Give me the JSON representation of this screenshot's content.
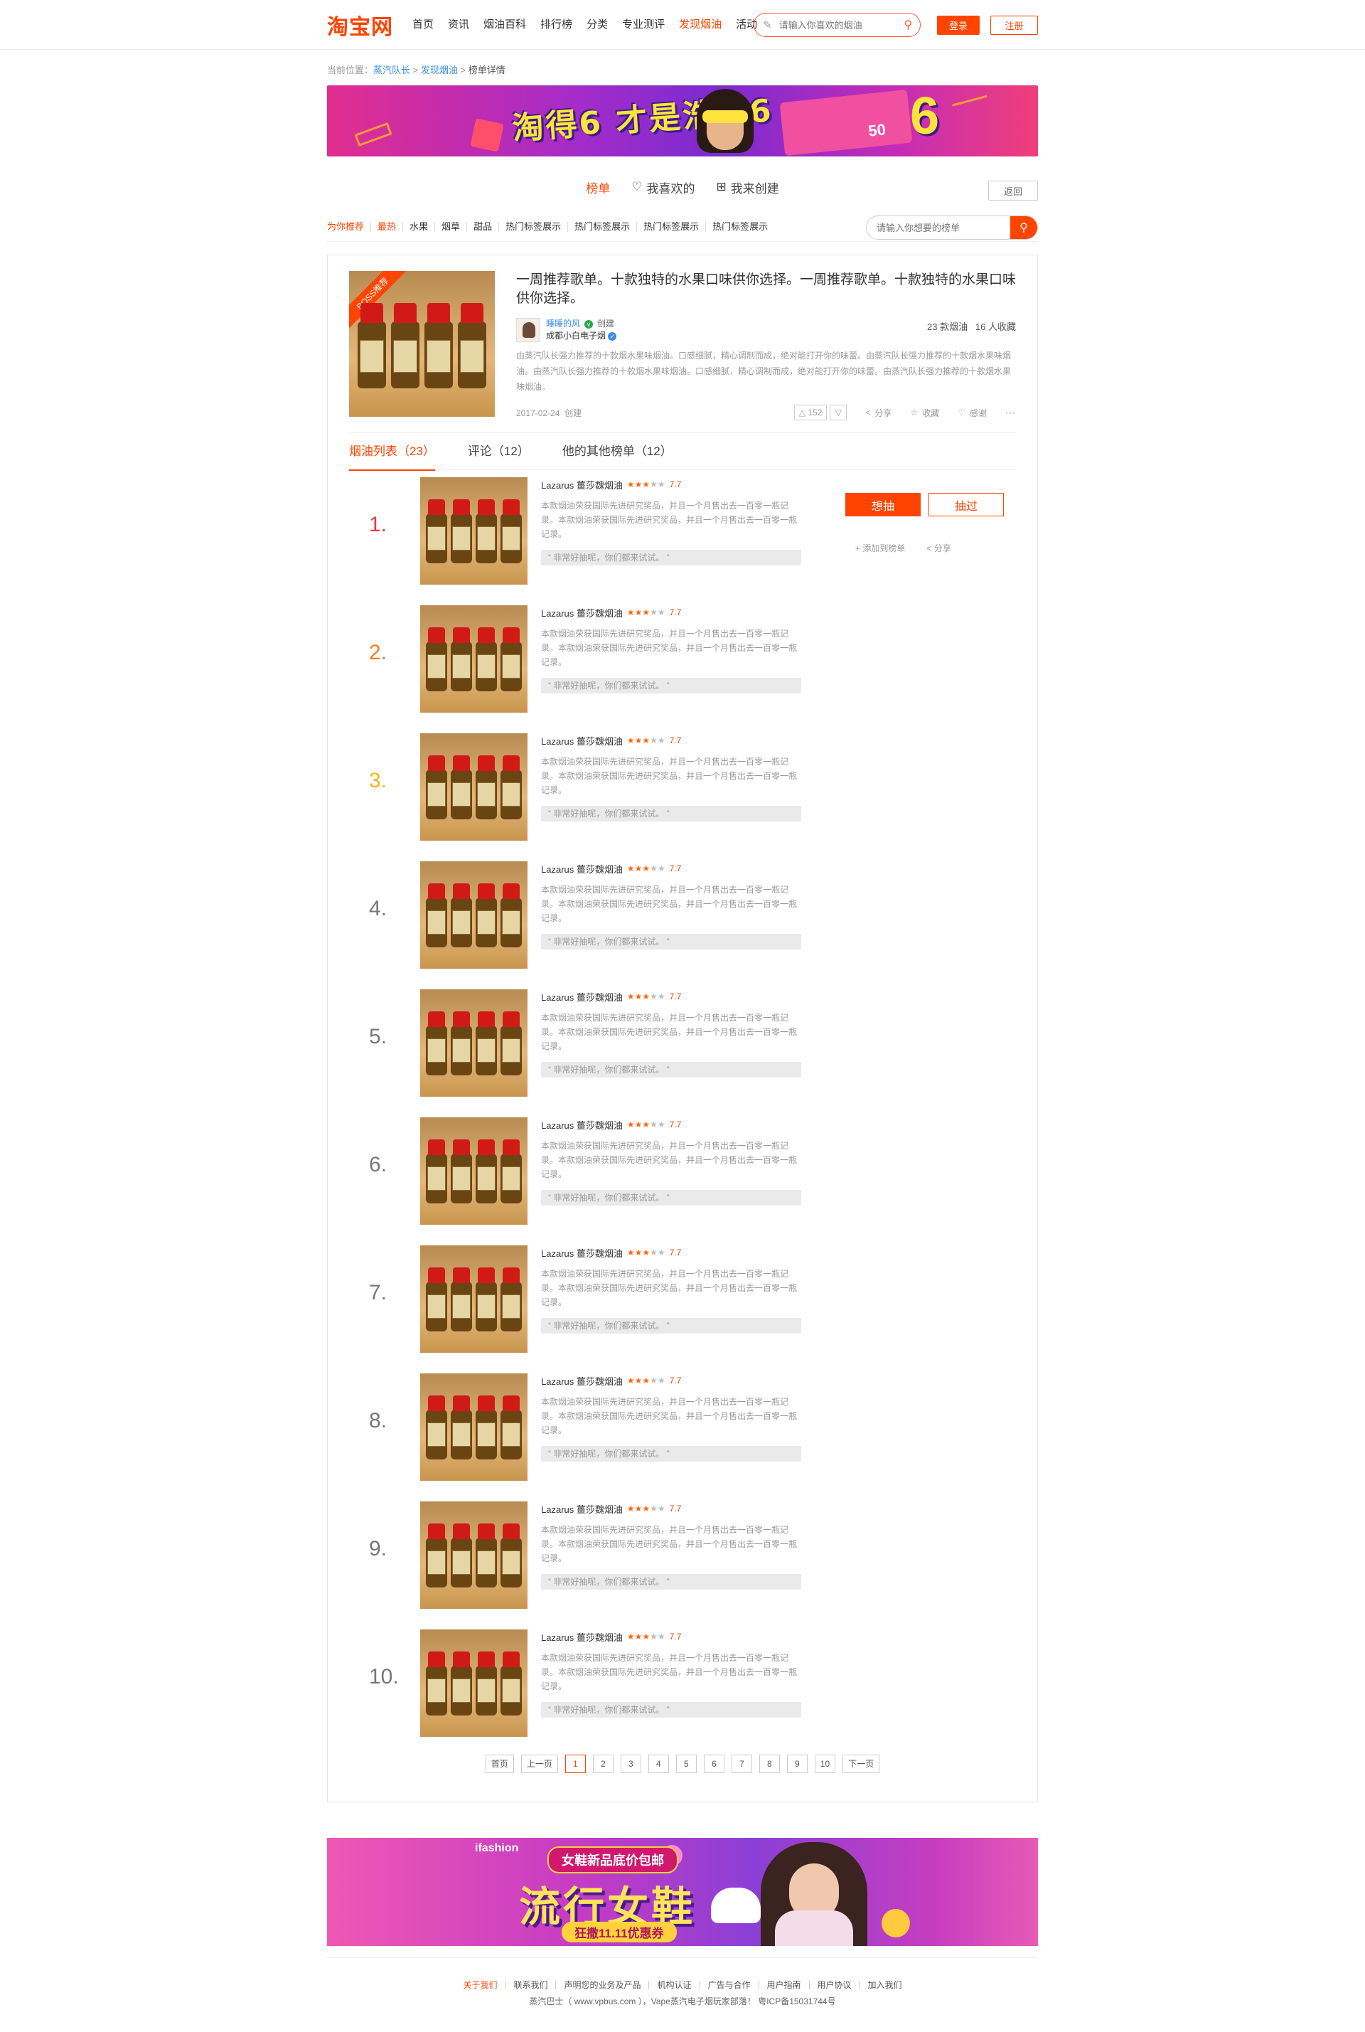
{
  "header": {
    "logo": "淘宝网",
    "nav": [
      "首页",
      "资讯",
      "烟油百科",
      "排行榜",
      "分类",
      "专业测评",
      "发现烟油",
      "活动"
    ],
    "nav_active_index": 6,
    "search_placeholder": "请输入你喜欢的烟油",
    "login": "登录",
    "register": "注册"
  },
  "breadcrumb": {
    "prefix": "当前位置：",
    "links": [
      "蒸汽队长",
      "发现烟油"
    ],
    "sep": " > ",
    "current": "榜单详情"
  },
  "tabs": {
    "items": [
      "榜单",
      "我喜欢的",
      "我来创建"
    ],
    "back": "返回"
  },
  "categories": [
    "为你推荐",
    "最热",
    "水果",
    "烟草",
    "甜品",
    "热门标签展示",
    "热门标签展示",
    "热门标签展示",
    "热门标签展示"
  ],
  "category_search_placeholder": "请输入你想要的榜单",
  "list": {
    "ribbon": "BOSS推荐",
    "title": "一周推荐歌单。十款独特的水果口味供你选择。一周推荐歌单。十款独特的水果口味供你选择。",
    "creator_name": "睡睡的风",
    "created_label": "创建",
    "creator_shop": "成都小白电子烟",
    "count": "23 款烟油",
    "favorites": "16 人收藏",
    "description": "由蒸汽队长强力推荐的十款烟水果味烟油。口感细腻，精心调制而成，绝对能打开你的味蕾。由蒸汽队长强力推荐的十款烟水果味烟油。由蒸汽队长强力推荐的十款烟水果味烟油。口感细腻，精心调制而成，绝对能打开你的味蕾。由蒸汽队长强力推荐的十款烟水果味烟油。",
    "date": "2017-02-24",
    "date_suffix": "创建",
    "likes": "152",
    "share": "分享",
    "collect": "收藏",
    "thanks": "感谢",
    "more": "···"
  },
  "subtabs": [
    "烟油列表（23）",
    "评论（12）",
    "他的其他榜单（12）"
  ],
  "items": [
    {
      "rank": "1.",
      "name": "Lazarus 薑莎魏烟油",
      "score": "7.7",
      "stars": 3
    },
    {
      "rank": "2.",
      "name": "Lazarus 薑莎魏烟油",
      "score": "7.7",
      "stars": 3
    },
    {
      "rank": "3.",
      "name": "Lazarus 薑莎魏烟油",
      "score": "7.7",
      "stars": 3
    },
    {
      "rank": "4.",
      "name": "Lazarus 薑莎魏烟油",
      "score": "7.7",
      "stars": 3
    },
    {
      "rank": "5.",
      "name": "Lazarus 薑莎魏烟油",
      "score": "7.7",
      "stars": 3
    },
    {
      "rank": "6.",
      "name": "Lazarus 薑莎魏烟油",
      "score": "7.7",
      "stars": 3
    },
    {
      "rank": "7.",
      "name": "Lazarus 薑莎魏烟油",
      "score": "7.7",
      "stars": 3
    },
    {
      "rank": "8.",
      "name": "Lazarus 薑莎魏烟油",
      "score": "7.7",
      "stars": 3
    },
    {
      "rank": "9.",
      "name": "Lazarus 薑莎魏烟油",
      "score": "7.7",
      "stars": 3
    },
    {
      "rank": "10.",
      "name": "Lazarus 薑莎魏烟油",
      "score": "7.7",
      "stars": 3
    }
  ],
  "item_text": "本款烟油荣获国际先进研究奖品，并且一个月售出去一百零一瓶记录。本款烟油荣获国际先进研究奖品，并且一个月售出去一百零一瓶记录。",
  "item_quote": "“ 非常好抽呢，你们都来试试。 ”",
  "item_actions": {
    "want": "想抽",
    "smoked": "抽过",
    "add": "添加到榜单",
    "share": "分享"
  },
  "pager": {
    "first": "首页",
    "prev": "上一页",
    "pages": [
      "1",
      "2",
      "3",
      "4",
      "5",
      "6",
      "7",
      "8",
      "9",
      "10"
    ],
    "current": "1",
    "next": "下一页"
  },
  "banner2": {
    "logo": "ifashion",
    "pill": "女鞋新品底价包邮",
    "big": "流行女鞋",
    "coupon": "狂撒11.11优惠券"
  },
  "footer": {
    "links": [
      "关于我们",
      "联系我们",
      "声明您的业务及产品",
      "机构认证",
      "广告与合作",
      "用户指南",
      "用户协议",
      "加入我们"
    ],
    "copy": "蒸汽巴士（ www.vpbus.com ），Vape蒸汽电子烟玩家部落！ 粤ICP备15031744号"
  },
  "colors": {
    "brand": "#ff4400",
    "link": "#3a8ee6",
    "rank1": "#e8393c",
    "rank2": "#f17b25",
    "rank3": "#f5b51c"
  }
}
